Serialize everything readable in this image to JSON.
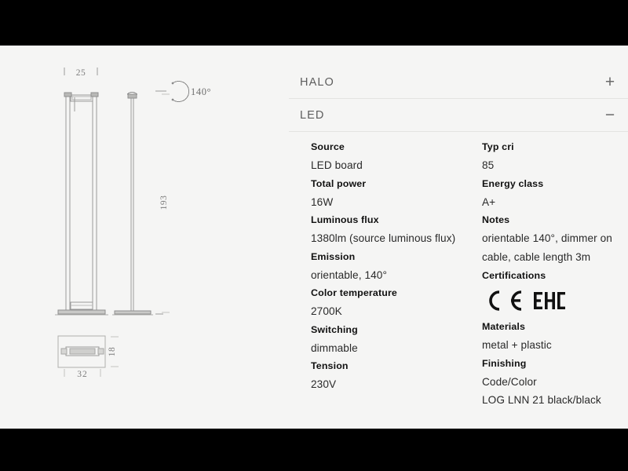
{
  "theme": {
    "letterbox_color": "#000000",
    "page_background": "#f5f5f4",
    "text_color": "#111111",
    "muted_text_color": "#5d5d5d",
    "rule_color": "#e3e3e1",
    "drawing_line_color": "#9a9a9a"
  },
  "accordion": {
    "items": [
      {
        "label": "HALO",
        "toggle": "+",
        "state": "collapsed"
      },
      {
        "label": "LED",
        "toggle": "−",
        "state": "expanded"
      }
    ]
  },
  "specs": {
    "left_column": [
      {
        "key": "Source",
        "value": "LED board"
      },
      {
        "key": "Total power",
        "value": "16W"
      },
      {
        "key": "Luminous flux",
        "value": "1380lm (source luminous flux)"
      },
      {
        "key": "Emission",
        "value": "orientable, 140°"
      },
      {
        "key": "Color temperature",
        "value": "2700K"
      },
      {
        "key": "Switching",
        "value": "dimmable"
      },
      {
        "key": "Tension",
        "value": "230V"
      }
    ],
    "right_column": [
      {
        "key": "Typ cri",
        "value": "85"
      },
      {
        "key": "Energy class",
        "value": "A+"
      },
      {
        "key": "Notes",
        "value_line1": "orientable 140°, dimmer on",
        "value_line2": "cable, cable length 3m"
      },
      {
        "key": "Certifications",
        "marks": [
          "CE",
          "EAC"
        ]
      },
      {
        "key": "Materials",
        "value": "metal + plastic"
      },
      {
        "key": "Finishing",
        "value_line1": "Code/Color",
        "value_line2": "LOG LNN 21 black/black"
      }
    ]
  },
  "drawing": {
    "dimensions": {
      "top_width": "25",
      "height": "193",
      "base_width": "32",
      "base_depth": "18"
    },
    "rotation_note": "140°"
  }
}
